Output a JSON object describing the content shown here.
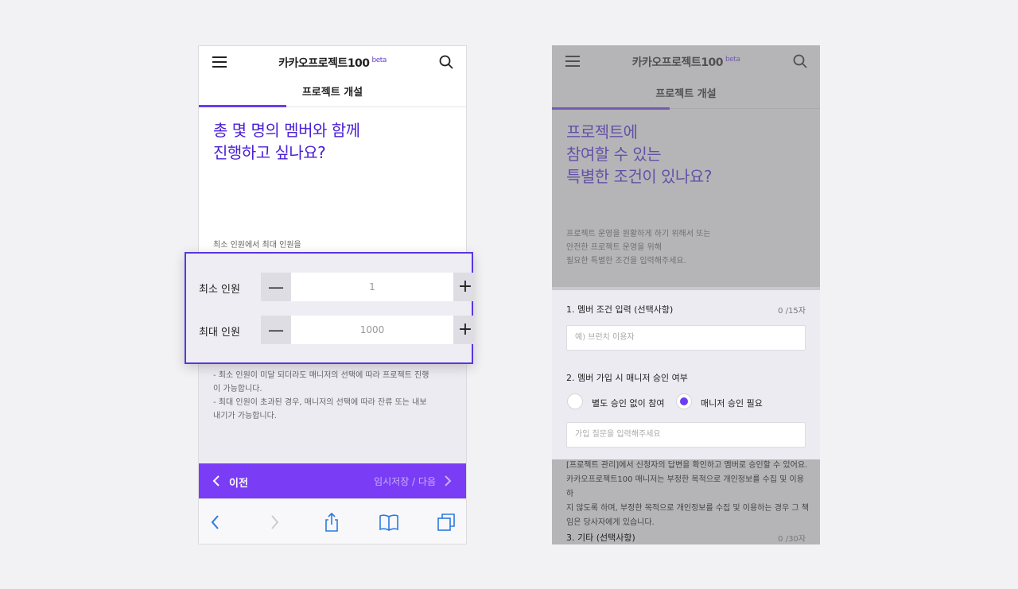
{
  "header": {
    "logo_main": "카카오프로젝트100",
    "logo_badge": "beta",
    "subtitle": "프로젝트 개설"
  },
  "screen1": {
    "question_line1": "총 몇 명의 멤버와 함께",
    "question_line2": "진행하고 싶나요?",
    "helper": "최소 인원에서 최대 인원을",
    "min_label": "최소 인원",
    "min_value": "1",
    "max_label": "최대 인원",
    "max_value": "1000",
    "minus_glyph": "—",
    "plus_glyph": "+",
    "note1_line1": "- 최소 인원이 미달 되더라도 매니저의 선택에 따라 프로젝트 진행",
    "note1_line2": "이 가능합니다.",
    "note2_line1": "- 최대 인원이 초과된 경우, 매니저의 선택에 따라 잔류 또는 내보",
    "note2_line2": "내기가 가능합니다.",
    "prev_label": "이전",
    "next_label": "임시저장 / 다음"
  },
  "screen2": {
    "question_line1": "프로젝트에",
    "question_line2": "참여할 수 있는",
    "question_line3": "특별한 조건이 있나요?",
    "desc_line1": "프로젝트 운영을 원활하게 하기 위해서 또는",
    "desc_line2": "안전한 프로젝트 운영을 위해",
    "desc_line3": "필요한 특별한 조건을 입력해주세요.",
    "field1_label": "1. 멤버 조건 입력 (선택사항)",
    "field1_count": "0 /15자",
    "field1_placeholder": "예) 브런치 이용자",
    "field2_label": "2. 멤버 가입 시 매니저 승인 여부",
    "radio1_label": "별도 승인 없이 참여",
    "radio2_label": "매니저 승인 필요",
    "field2_placeholder": "가입 질문을 입력해주세요",
    "notice_line1": "[프로젝트 관리]에서 신청자의 답변을 확인하고 멤버로 승인할 수 있어요.",
    "notice_line2": "카카오프로젝트100 매니저는 부정한 목적으로 개인정보를 수집 및 이용하",
    "notice_line3": "지 않도록 하며, 부정한 목적으로 개인정보를 수집 및 이용하는 경우 그 책",
    "notice_line4": "임은 당사자에게 있습니다.",
    "field3_label": "3. 기타 (선택사항)",
    "field3_count": "0 /30자"
  },
  "colors": {
    "accent": "#6a3df0",
    "bottom_bar": "#7a3cf5",
    "title": "#4a1fd6"
  }
}
